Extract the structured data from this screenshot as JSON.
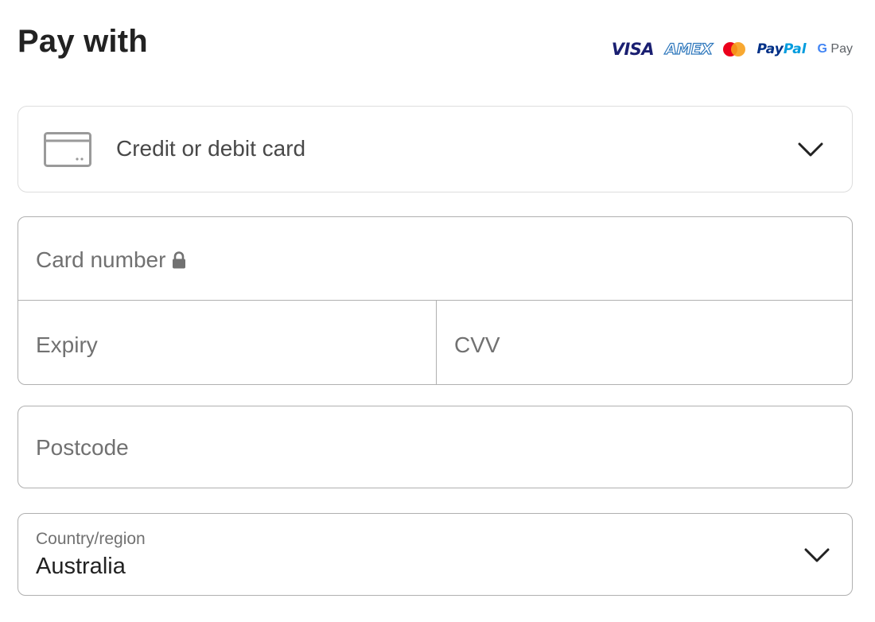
{
  "header": {
    "title": "Pay with"
  },
  "payment_logos": {
    "visa": "VISA",
    "amex": "AMEX",
    "paypal_pay": "Pay",
    "paypal_pal": "Pal",
    "gpay_g": "G",
    "gpay_text": "Pay",
    "colors": {
      "visa": "#1a1f71",
      "amex": "#2e77bc",
      "mastercard_red": "#eb001b",
      "mastercard_orange": "#f79e1b",
      "paypal_dark": "#003087",
      "paypal_light": "#009cde"
    }
  },
  "payment_method": {
    "icon": "credit-card-icon",
    "label": "Credit or debit card",
    "dropdown_icon": "chevron-down-icon"
  },
  "card_fields": {
    "card_number_placeholder": "Card number",
    "card_number_icon": "lock-icon",
    "expiry_placeholder": "Expiry",
    "cvv_placeholder": "CVV"
  },
  "postcode": {
    "placeholder": "Postcode"
  },
  "country": {
    "label": "Country/region",
    "value": "Australia",
    "dropdown_icon": "chevron-down-icon"
  }
}
